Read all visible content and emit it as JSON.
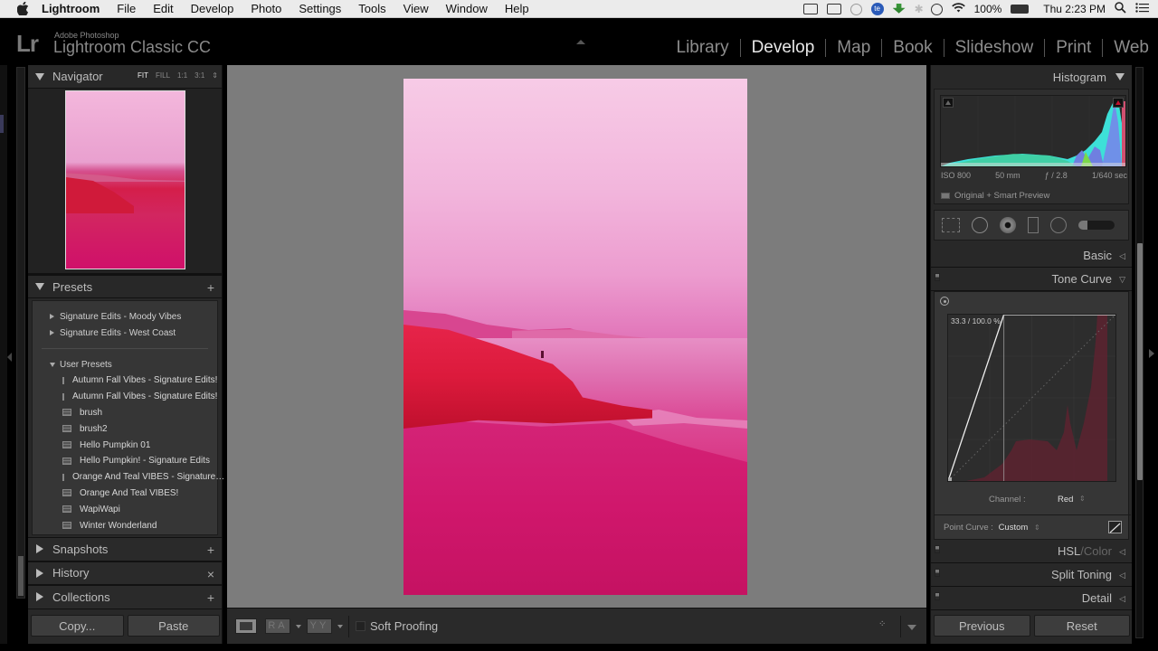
{
  "menubar": {
    "app_name": "Lightroom",
    "items": [
      "File",
      "Edit",
      "Develop",
      "Photo",
      "Settings",
      "Tools",
      "View",
      "Window",
      "Help"
    ],
    "status": {
      "battery": "100%",
      "clock": "Thu 2:23 PM"
    }
  },
  "identity": {
    "logo": "Lr",
    "vendor": "Adobe Photoshop",
    "product": "Lightroom Classic CC"
  },
  "modules": [
    {
      "label": "Library",
      "active": false
    },
    {
      "label": "Develop",
      "active": true
    },
    {
      "label": "Map",
      "active": false
    },
    {
      "label": "Book",
      "active": false
    },
    {
      "label": "Slideshow",
      "active": false
    },
    {
      "label": "Print",
      "active": false
    },
    {
      "label": "Web",
      "active": false
    }
  ],
  "left_panel": {
    "navigator": {
      "title": "Navigator",
      "zoom_options": [
        "FIT",
        "FILL",
        "1:1",
        "3:1"
      ],
      "selected_zoom": "FIT"
    },
    "presets": {
      "title": "Presets",
      "add_label": "+",
      "folders": [
        {
          "label": "Signature Edits - Moody Vibes",
          "expanded": false
        },
        {
          "label": "Signature Edits - West Coast",
          "expanded": false
        }
      ],
      "user_presets": {
        "label": "User Presets",
        "expanded": true,
        "items": [
          "Autumn Fall Vibes - Signature Edits!",
          "Autumn Fall Vibes - Signature Edits!",
          "brush",
          "brush2",
          "Hello Pumpkin 01",
          "Hello Pumpkin! - Signature Edits",
          "Orange And Teal VIBES - Signature…",
          "Orange And Teal VIBES!",
          "WapiWapi",
          "Winter Wonderland"
        ]
      }
    },
    "snapshots": {
      "title": "Snapshots",
      "action": "+"
    },
    "history": {
      "title": "History",
      "action": "×"
    },
    "collections": {
      "title": "Collections",
      "action": "+"
    },
    "copy_label": "Copy...",
    "paste_label": "Paste"
  },
  "toolbar": {
    "ra_label": "RA",
    "yy_label": "YY",
    "soft_proofing_label": "Soft Proofing",
    "soft_proofing_checked": false
  },
  "right_panel": {
    "histogram": {
      "title": "Histogram",
      "iso": "ISO 800",
      "focal_length": "50 mm",
      "aperture": "ƒ / 2.8",
      "shutter": "1/640 sec",
      "preview_label": "Original + Smart Preview"
    },
    "tools": [
      "crop-overlay",
      "spot-removal",
      "red-eye",
      "graduated-filter",
      "radial-filter",
      "adjustment-brush"
    ],
    "sections": {
      "basic": "Basic",
      "tone_curve": "Tone Curve",
      "hsl": "HSL",
      "hsl_sep": "/",
      "color": "Color",
      "split_toning": "Split Toning",
      "detail": "Detail"
    },
    "tone_curve": {
      "readout": "33.3 / 100.0 %",
      "channel_label": "Channel :",
      "channel_value": "Red",
      "point_curve_label": "Point Curve :",
      "point_curve_value": "Custom",
      "curve_points": [
        [
          0,
          0
        ],
        [
          33.3,
          100.0
        ],
        [
          100,
          100
        ]
      ]
    },
    "previous_label": "Previous",
    "reset_label": "Reset"
  },
  "colors": {
    "accent_red": "#c0102e",
    "panel_bg": "#282828",
    "canvas_bg": "#7c7c7c"
  }
}
